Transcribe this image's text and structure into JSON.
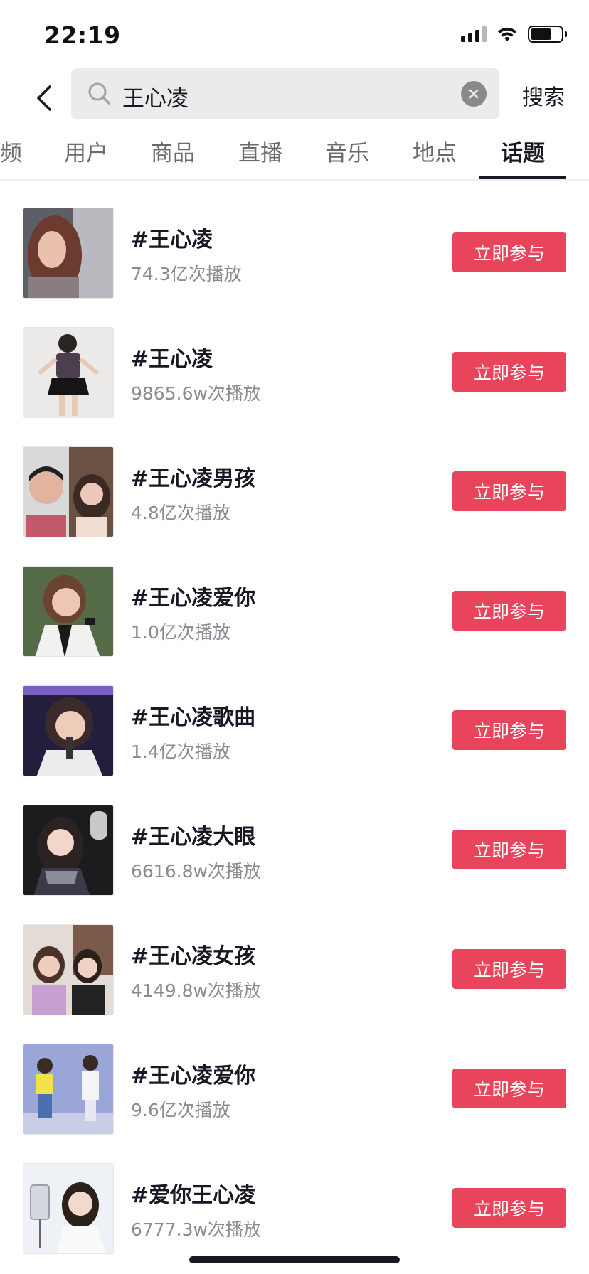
{
  "status_bar": {
    "time": "22:19"
  },
  "search": {
    "query": "王心凌",
    "submit_label": "搜索"
  },
  "tabs": [
    {
      "label": "频",
      "active": false
    },
    {
      "label": "用户",
      "active": false
    },
    {
      "label": "商品",
      "active": false
    },
    {
      "label": "直播",
      "active": false
    },
    {
      "label": "音乐",
      "active": false
    },
    {
      "label": "地点",
      "active": false
    },
    {
      "label": "话题",
      "active": true
    }
  ],
  "topics": [
    {
      "title": "#王心凌",
      "views": "74.3亿次播放",
      "button": "立即参与"
    },
    {
      "title": "#王心凌",
      "views": "9865.6w次播放",
      "button": "立即参与"
    },
    {
      "title": "#王心凌男孩",
      "views": "4.8亿次播放",
      "button": "立即参与"
    },
    {
      "title": "#王心凌爱你",
      "views": "1.0亿次播放",
      "button": "立即参与"
    },
    {
      "title": "#王心凌歌曲",
      "views": "1.4亿次播放",
      "button": "立即参与"
    },
    {
      "title": "#王心凌大眼",
      "views": "6616.8w次播放",
      "button": "立即参与"
    },
    {
      "title": "#王心凌女孩",
      "views": "4149.8w次播放",
      "button": "立即参与"
    },
    {
      "title": "#王心凌爱你",
      "views": "9.6亿次播放",
      "button": "立即参与"
    },
    {
      "title": "#爱你王心凌",
      "views": "6777.3w次播放",
      "button": "立即参与"
    }
  ],
  "colors": {
    "accent": "#e8455d",
    "text": "#161823",
    "secondary": "#8a8b91"
  }
}
